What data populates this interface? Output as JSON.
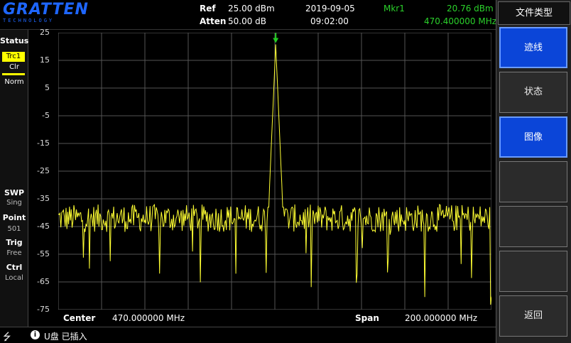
{
  "logo": {
    "main": "GRATTEN",
    "sub": "TECHNOLOGY"
  },
  "header": {
    "ref_label": "Ref",
    "ref_value": "25.00 dBm",
    "atten_label": "Atten",
    "atten_value": "50.00 dB",
    "date": "2019-09-05",
    "time": "09:02:00",
    "marker_label": "Mkr1",
    "marker_amplitude": "20.76 dBm",
    "marker_frequency": "470.400000 MHz"
  },
  "status_panel": {
    "title": "Status",
    "trace": "Trc1",
    "trace_mode": "Clr",
    "detector": "Norm",
    "swp_label": "SWP",
    "swp_value": "Sing",
    "point_label": "Point",
    "point_value": "501",
    "trig_label": "Trig",
    "trig_value": "Free",
    "ctrl_label": "Ctrl",
    "ctrl_value": "Local"
  },
  "chart_data": {
    "type": "line",
    "yticks": [
      "25",
      "15",
      "5",
      "-5",
      "-15",
      "-25",
      "-35",
      "-45",
      "-55",
      "-65",
      "-75"
    ],
    "ylim": [
      -75,
      25
    ],
    "xlim": [
      370,
      570
    ],
    "series": [
      {
        "noise_floor_dbm": -42,
        "peak": {
          "x_mhz": 470.4,
          "y_dbm": 20.76
        }
      }
    ],
    "trace_color": "#ffff33",
    "grid": true,
    "marker_color": "#22cc22"
  },
  "footer": {
    "center_label": "Center",
    "center_value": "470.000000 MHz",
    "span_label": "Span",
    "span_value": "200.000000 MHz"
  },
  "statusbar": {
    "usb_icon": "usb-icon",
    "message": "U盘 已插入"
  },
  "menu": {
    "title": "文件类型",
    "items": [
      "迹线",
      "状态",
      "图像",
      "",
      "",
      "",
      "返回"
    ]
  }
}
